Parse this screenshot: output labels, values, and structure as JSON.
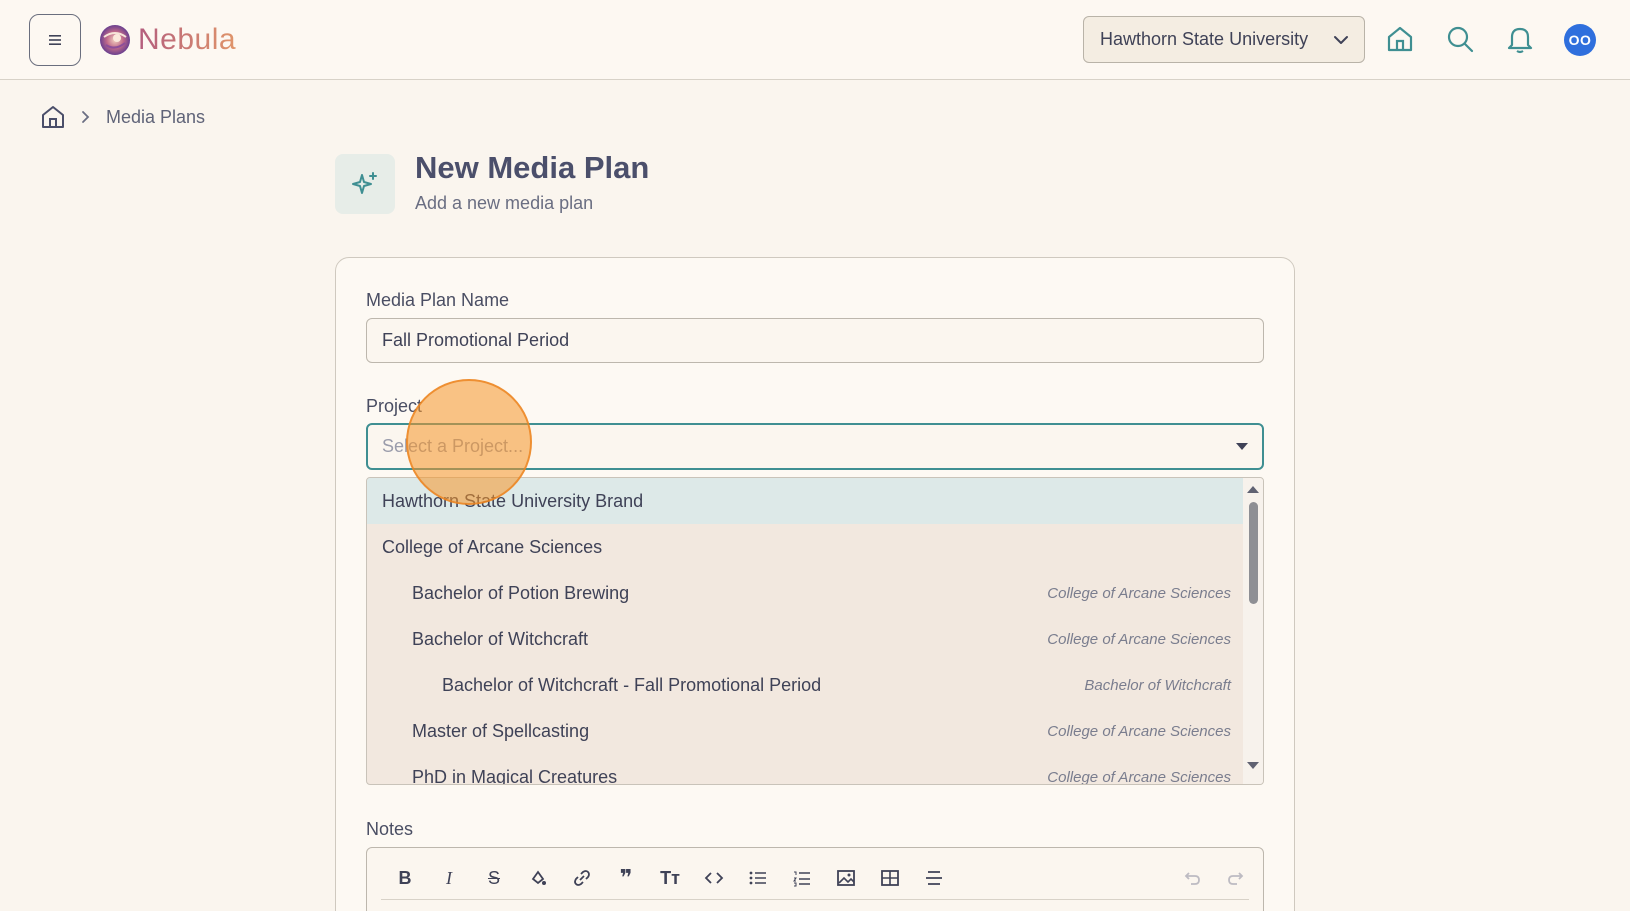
{
  "header": {
    "app_name": "Nebula",
    "org_selector": "Hawthorn State University",
    "avatar_initials": "OO"
  },
  "breadcrumb": {
    "current": "Media Plans"
  },
  "page": {
    "title": "New Media Plan",
    "subtitle": "Add a new media plan"
  },
  "form": {
    "name_label": "Media Plan Name",
    "name_value": "Fall Promotional Period",
    "project_label": "Project",
    "project_placeholder": "Select a Project...",
    "notes_label": "Notes"
  },
  "dropdown": {
    "options": [
      {
        "label": "Hawthorn State University Brand",
        "parent": "",
        "level": 0
      },
      {
        "label": "College of Arcane Sciences",
        "parent": "",
        "level": 0
      },
      {
        "label": "Bachelor of Potion Brewing",
        "parent": "College of Arcane Sciences",
        "level": 1
      },
      {
        "label": "Bachelor of Witchcraft",
        "parent": "College of Arcane Sciences",
        "level": 1
      },
      {
        "label": "Bachelor of Witchcraft - Fall Promotional Period",
        "parent": "Bachelor of Witchcraft",
        "level": 2
      },
      {
        "label": "Master of Spellcasting",
        "parent": "College of Arcane Sciences",
        "level": 1
      },
      {
        "label": "PhD in Magical Creatures",
        "parent": "College of Arcane Sciences",
        "level": 1
      }
    ]
  },
  "colors": {
    "accent": "#3f8f92",
    "avatar": "#2f6fdd",
    "background": "#faf5ee"
  },
  "toolbar_icons": [
    "bold-icon",
    "italic-icon",
    "strikethrough-icon",
    "highlight-icon",
    "link-icon",
    "quote-icon",
    "text-size-icon",
    "code-icon",
    "bullet-list-icon",
    "numbered-list-icon",
    "image-icon",
    "table-icon",
    "horizontal-rule-icon",
    "undo-icon",
    "redo-icon"
  ]
}
